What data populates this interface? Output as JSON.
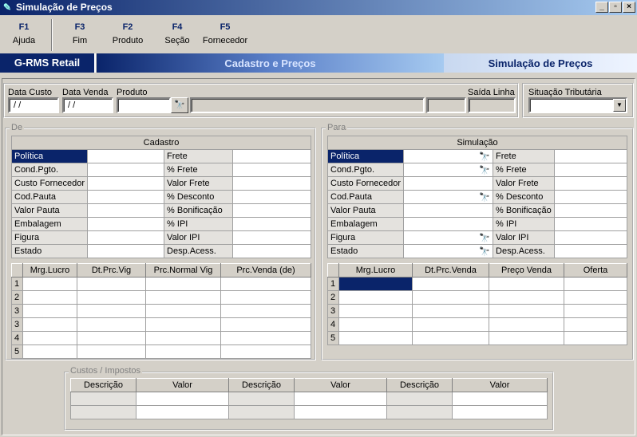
{
  "window": {
    "title": "Simulação de Preços"
  },
  "fkeys": [
    {
      "key": "F1",
      "label": "Ajuda"
    },
    {
      "key": "F3",
      "label": "Fim"
    },
    {
      "key": "F2",
      "label": "Produto"
    },
    {
      "key": "F4",
      "label": "Seção"
    },
    {
      "key": "F5",
      "label": "Fornecedor"
    }
  ],
  "banner": {
    "app": "G-RMS Retail",
    "module": "Cadastro e Preços",
    "screen": "Simulação de Preços"
  },
  "top": {
    "data_custo_label": "Data Custo",
    "data_custo_value": " / /",
    "data_venda_label": "Data Venda",
    "data_venda_value": " / /",
    "produto_label": "Produto",
    "saida_linha_label": "Saída Linha",
    "situacao_label": "Situação Tributária"
  },
  "de": {
    "legend": "De",
    "header": "Cadastro",
    "left_labels": [
      "Política",
      "Cond.Pgto.",
      "Custo Fornecedor",
      "Cod.Pauta",
      "Valor Pauta",
      "Embalagem",
      "Figura",
      "Estado"
    ],
    "right_labels": [
      "Frete",
      "% Frete",
      "Valor Frete",
      "% Desconto",
      "% Bonificação",
      "% IPI",
      "Valor IPI",
      "Desp.Acess."
    ],
    "grid_cols": [
      "Mrg.Lucro",
      "Dt.Prc.Vig",
      "Prc.Normal Vig",
      "Prc.Venda (de)"
    ],
    "rows": [
      "1",
      "2",
      "3",
      "3",
      "4",
      "5"
    ]
  },
  "para": {
    "legend": "Para",
    "header": "Simulação",
    "left_labels": [
      "Política",
      "Cond.Pgto.",
      "Custo Fornecedor",
      "Cod.Pauta",
      "Valor Pauta",
      "Embalagem",
      "Figura",
      "Estado"
    ],
    "right_labels": [
      "Frete",
      "% Frete",
      "Valor Frete",
      "% Desconto",
      "% Bonificação",
      "% IPI",
      "Valor IPI",
      "Desp.Acess."
    ],
    "grid_cols": [
      "Mrg.Lucro",
      "Dt.Prc.Venda",
      "Preço Venda",
      "Oferta"
    ],
    "rows": [
      "1",
      "2",
      "3",
      "4",
      "5"
    ]
  },
  "custos": {
    "legend": "Custos / Impostos",
    "cols": [
      "Descrição",
      "Valor",
      "Descrição",
      "Valor",
      "Descrição",
      "Valor"
    ]
  },
  "icons": {
    "binoculars": "🔭"
  }
}
